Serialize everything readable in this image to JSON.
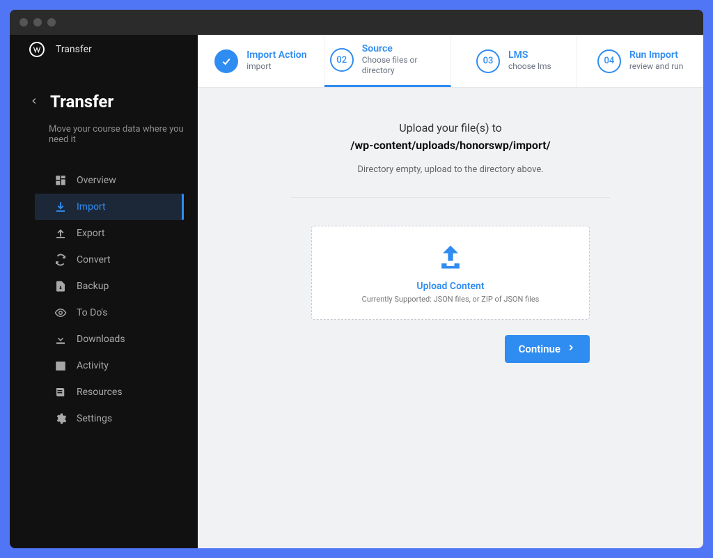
{
  "app": {
    "name": "Transfer",
    "page_title": "Transfer",
    "subtitle": "Move your course data where you need it"
  },
  "nav": {
    "items": [
      {
        "label": "Overview",
        "icon": "grid"
      },
      {
        "label": "Import",
        "icon": "download",
        "active": true
      },
      {
        "label": "Export",
        "icon": "upload"
      },
      {
        "label": "Convert",
        "icon": "refresh"
      },
      {
        "label": "Backup",
        "icon": "archive"
      },
      {
        "label": "To Do's",
        "icon": "eye"
      },
      {
        "label": "Downloads",
        "icon": "arrow-down"
      },
      {
        "label": "Activity",
        "icon": "box"
      },
      {
        "label": "Resources",
        "icon": "book"
      },
      {
        "label": "Settings",
        "icon": "gear"
      }
    ]
  },
  "stepper": {
    "steps": [
      {
        "num": "",
        "title": "Import Action",
        "sub": "import",
        "state": "done"
      },
      {
        "num": "02",
        "title": "Source",
        "sub": "Choose files or directory",
        "state": "active"
      },
      {
        "num": "03",
        "title": "LMS",
        "sub": "choose lms",
        "state": "pending"
      },
      {
        "num": "04",
        "title": "Run Import",
        "sub": "review and run",
        "state": "pending"
      }
    ]
  },
  "upload": {
    "heading": "Upload your file(s) to",
    "path": "/wp-content/uploads/honorswp/import/",
    "note": "Directory empty, upload to the directory above.",
    "drop_title": "Upload Content",
    "drop_sub": "Currently Supported: JSON files, or ZIP of JSON files",
    "continue_label": "Continue"
  }
}
